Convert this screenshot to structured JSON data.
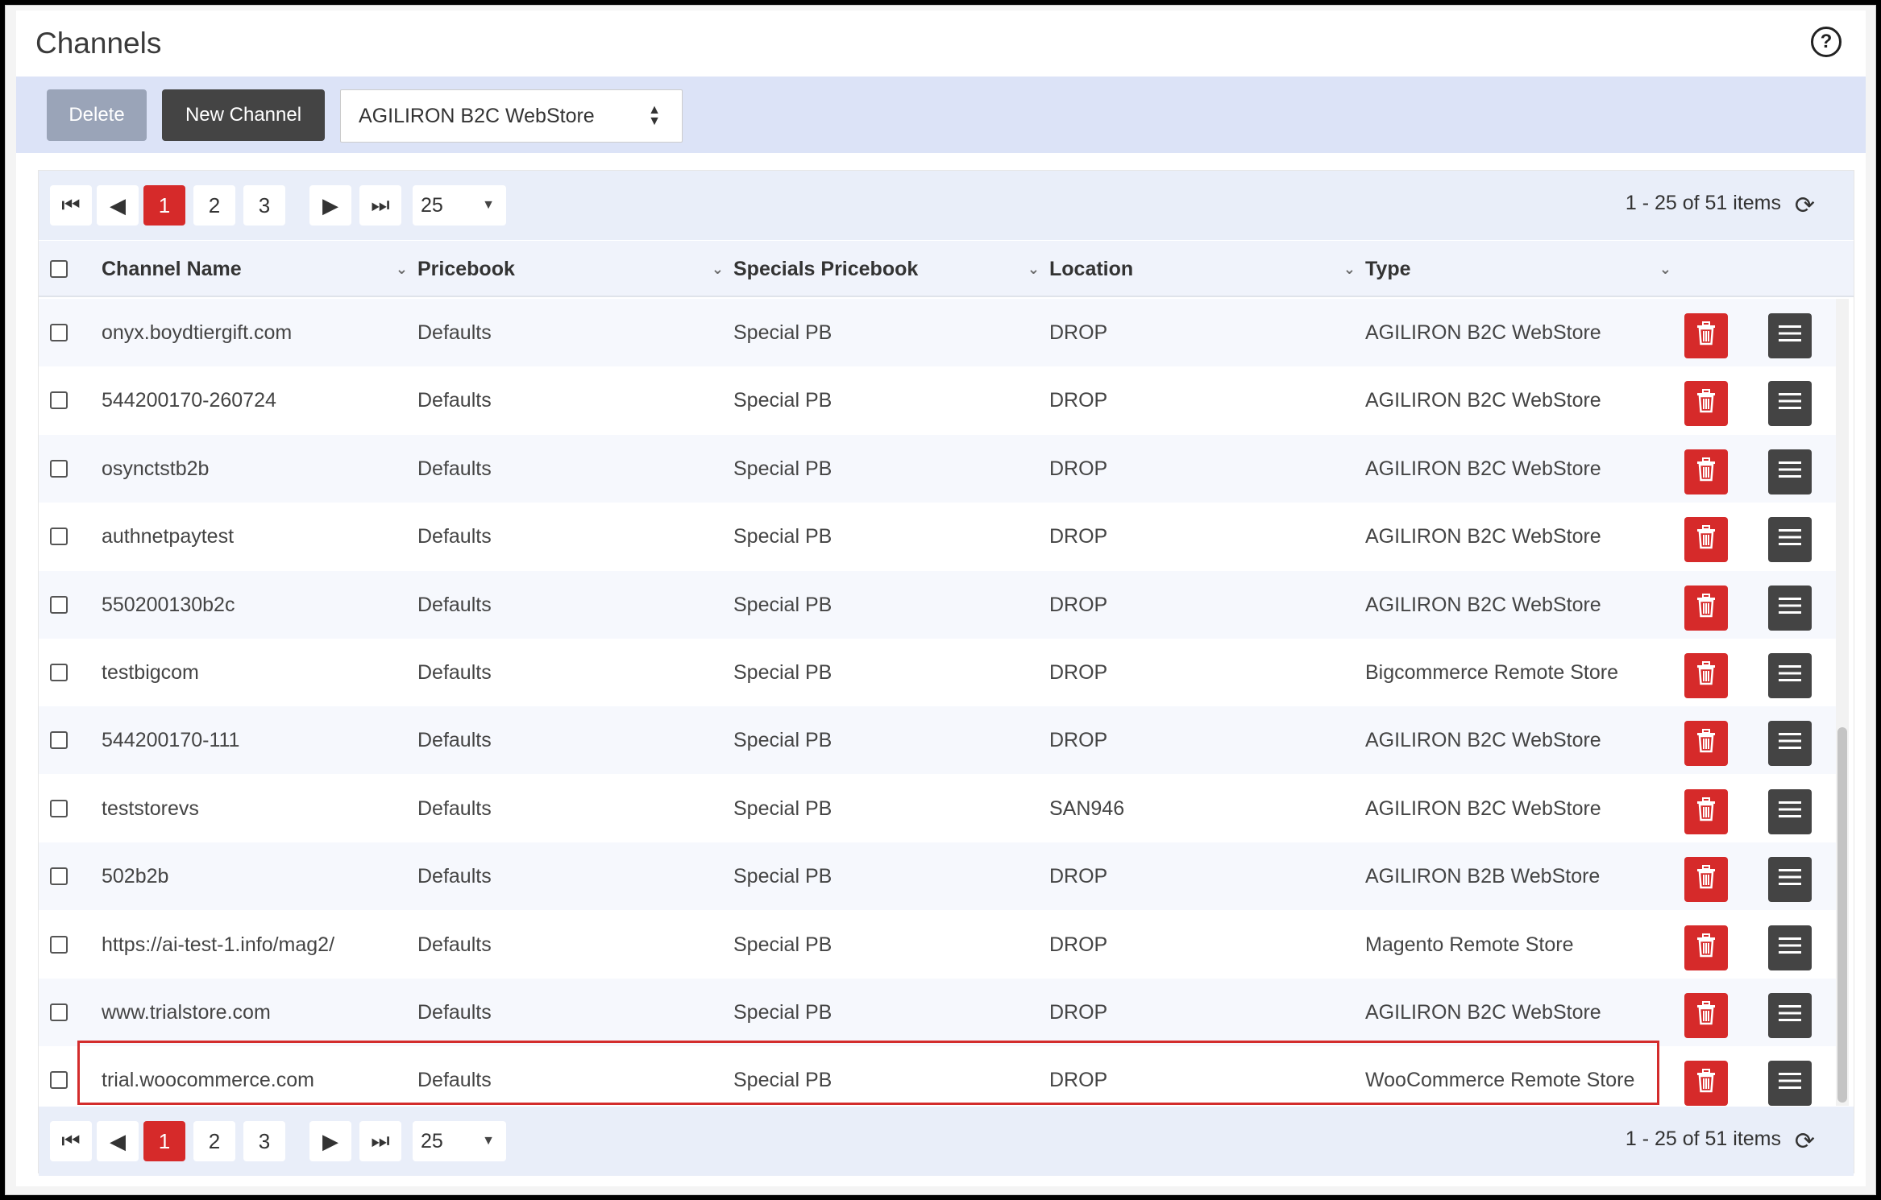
{
  "page": {
    "title": "Channels"
  },
  "toolbar": {
    "delete_label": "Delete",
    "new_channel_label": "New Channel",
    "store_type_selected": "AGILIRON B2C WebStore"
  },
  "pager": {
    "pages": [
      "1",
      "2",
      "3"
    ],
    "active_page": "1",
    "page_size": "25",
    "info": "1 - 25 of 51 items"
  },
  "columns": {
    "channel_name": "Channel Name",
    "pricebook": "Pricebook",
    "specials_pricebook": "Specials Pricebook",
    "location": "Location",
    "type": "Type"
  },
  "rows": [
    {
      "name": "onyx.boydtiergift.com",
      "pricebook": "Defaults",
      "specials": "Special PB",
      "location": "DROP",
      "type": "AGILIRON B2C WebStore"
    },
    {
      "name": "544200170-260724",
      "pricebook": "Defaults",
      "specials": "Special PB",
      "location": "DROP",
      "type": "AGILIRON B2C WebStore"
    },
    {
      "name": "osynctstb2b",
      "pricebook": "Defaults",
      "specials": "Special PB",
      "location": "DROP",
      "type": "AGILIRON B2C WebStore"
    },
    {
      "name": "authnetpaytest",
      "pricebook": "Defaults",
      "specials": "Special PB",
      "location": "DROP",
      "type": "AGILIRON B2C WebStore"
    },
    {
      "name": "550200130b2c",
      "pricebook": "Defaults",
      "specials": "Special PB",
      "location": "DROP",
      "type": "AGILIRON B2C WebStore"
    },
    {
      "name": "testbigcom",
      "pricebook": "Defaults",
      "specials": "Special PB",
      "location": "DROP",
      "type": "Bigcommerce Remote Store"
    },
    {
      "name": "544200170-111",
      "pricebook": "Defaults",
      "specials": "Special PB",
      "location": "DROP",
      "type": "AGILIRON B2C WebStore"
    },
    {
      "name": "teststorevs",
      "pricebook": "Defaults",
      "specials": "Special PB",
      "location": "SAN946",
      "type": "AGILIRON B2C WebStore"
    },
    {
      "name": "502b2b",
      "pricebook": "Defaults",
      "specials": "Special PB",
      "location": "DROP",
      "type": "AGILIRON B2B WebStore"
    },
    {
      "name": "https://ai-test-1.info/mag2/",
      "pricebook": "Defaults",
      "specials": "Special PB",
      "location": "DROP",
      "type": "Magento Remote Store"
    },
    {
      "name": "www.trialstore.com",
      "pricebook": "Defaults",
      "specials": "Special PB",
      "location": "DROP",
      "type": "AGILIRON B2C WebStore"
    },
    {
      "name": "trial.woocommerce.com",
      "pricebook": "Defaults",
      "specials": "Special PB",
      "location": "DROP",
      "type": "WooCommerce Remote Store"
    }
  ],
  "highlighted_row_index": 11,
  "colors": {
    "accent": "#d62a2a",
    "toolbar_bg": "#dce3f7",
    "dark_button": "#444444"
  }
}
